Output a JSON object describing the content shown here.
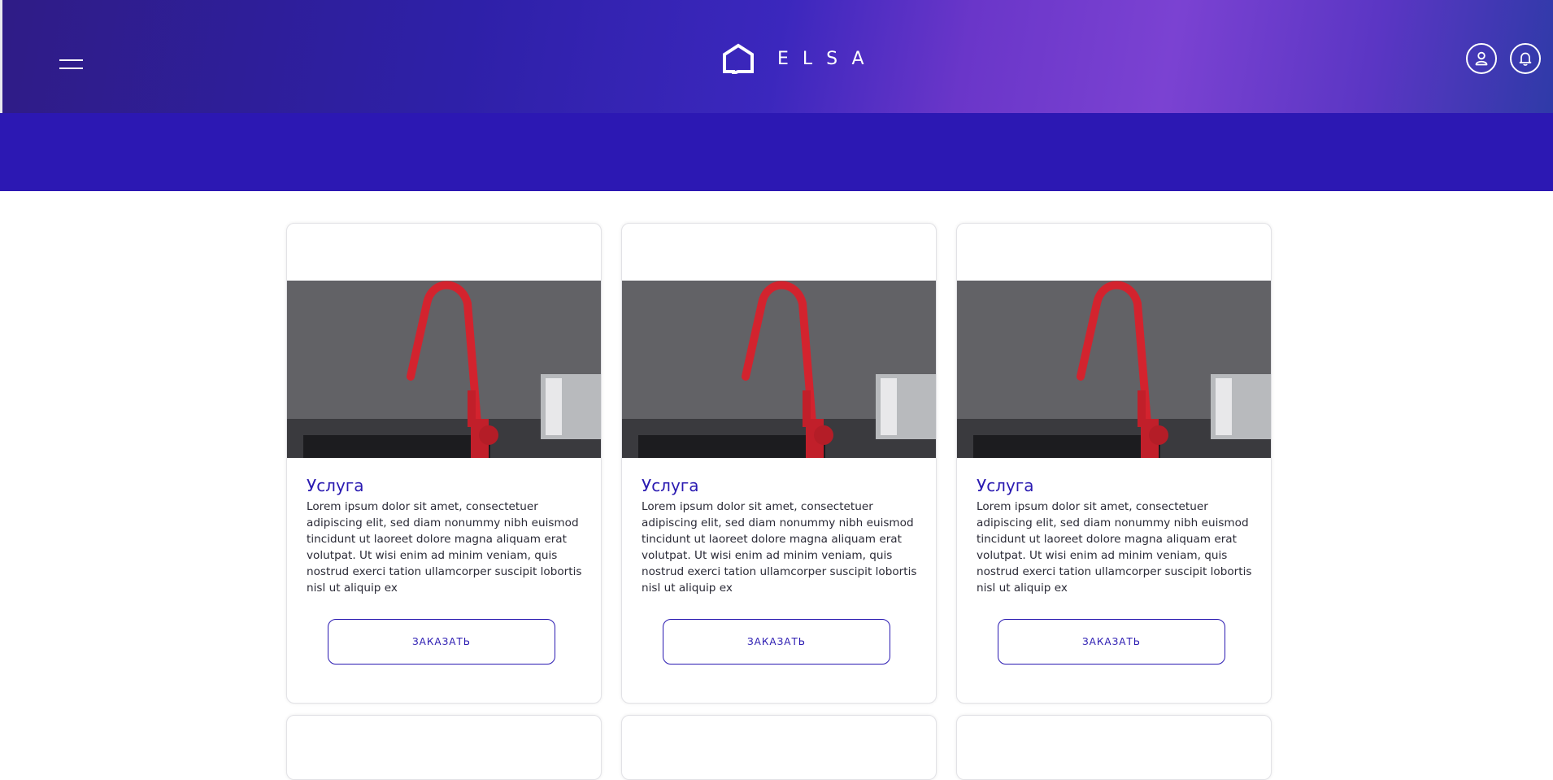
{
  "header": {
    "logo_text": "ELSA",
    "menu_icon": "hamburger-menu-icon",
    "account_icon": "user-icon",
    "notifications_icon": "bell-icon"
  },
  "colors": {
    "accent": "#2a1ab1",
    "band": "#2c18b3"
  },
  "cards": [
    {
      "title": "Услуга",
      "text": "Lorem ipsum dolor sit amet, consectetuer adipiscing elit, sed diam nonummy nibh euismod tincidunt ut laoreet dolore magna aliquam erat volutpat. Ut wisi enim ad minim veniam, quis nostrud exerci tation ullamcorper suscipit lobortis nisl ut aliquip ex",
      "button_label": "ЗАКАЗАТЬ"
    },
    {
      "title": "Услуга",
      "text": "Lorem ipsum dolor sit amet, consectetuer adipiscing elit, sed diam nonummy nibh euismod tincidunt ut laoreet dolore magna aliquam erat volutpat. Ut wisi enim ad minim veniam, quis nostrud exerci tation ullamcorper suscipit lobortis nisl ut aliquip ex",
      "button_label": "ЗАКАЗАТЬ"
    },
    {
      "title": "Услуга",
      "text": "Lorem ipsum dolor sit amet, consectetuer adipiscing elit, sed diam nonummy nibh euismod tincidunt ut laoreet dolore magna aliquam erat volutpat. Ut wisi enim ad minim veniam, quis nostrud exerci tation ullamcorper suscipit lobortis nisl ut aliquip ex",
      "button_label": "ЗАКАЗАТЬ"
    }
  ]
}
